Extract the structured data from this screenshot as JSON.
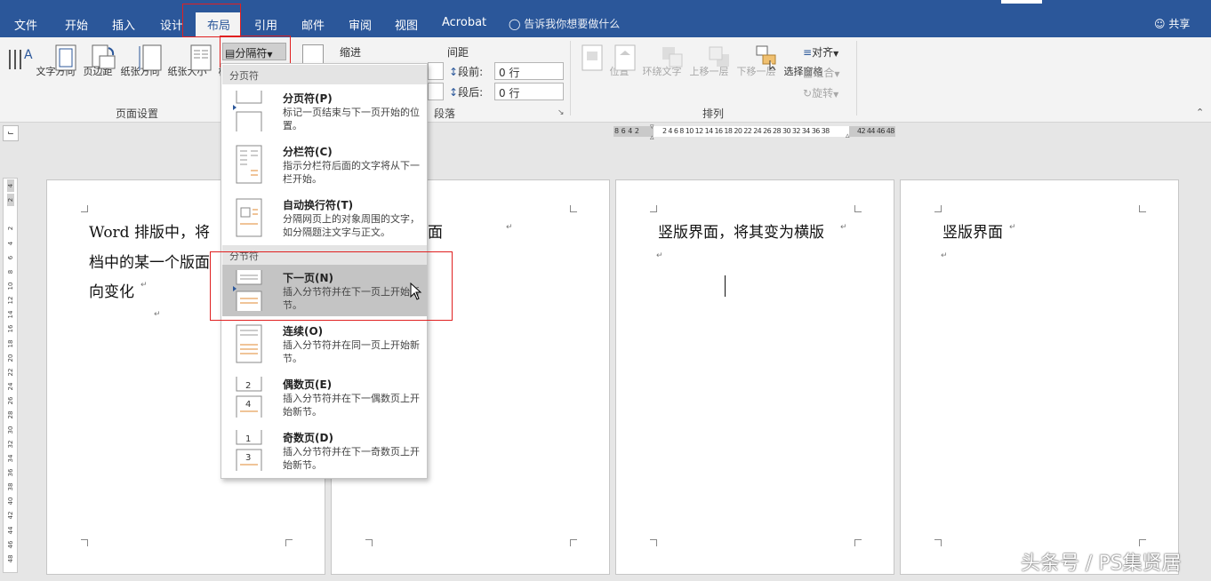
{
  "tabs": [
    "文件",
    "开始",
    "插入",
    "设计",
    "布局",
    "引用",
    "邮件",
    "审阅",
    "视图",
    "Acrobat"
  ],
  "tell_me": "告诉我你想要做什么",
  "share": "共享",
  "ribbon": {
    "text_direction": "文字方向",
    "margins": "页边距",
    "orientation": "纸张方向",
    "size": "纸张大小",
    "columns": "栏",
    "breaks": "分隔符",
    "page_setup_group": "页面设置",
    "indent": "缩进",
    "spacing": "间距",
    "before_label": "段前:",
    "after_label": "段后:",
    "before_value": "0 行",
    "after_value": "0 行",
    "paragraph_group": "段落",
    "position": "位置",
    "wrap_text": "环绕文字",
    "bring_forward": "上移一层",
    "send_backward": "下移一层",
    "selection_pane": "选择窗格",
    "align": "对齐",
    "group": "组合",
    "rotate": "旋转",
    "arrange_group": "排列"
  },
  "ruler": {
    "h_left": "8  6  4  2",
    "h_main": "2  4  6  8 10 12 14 16 18 20 22 24 26 28 30 32 34 36 38",
    "h_right": "42 44 46 48",
    "v_ticks": [
      "4",
      "2",
      "",
      "2",
      "4",
      "6",
      "8",
      "10",
      "12",
      "14",
      "16",
      "18",
      "20",
      "22",
      "24",
      "26",
      "28",
      "30",
      "32",
      "34",
      "36",
      "38",
      "40",
      "42",
      "44",
      "46",
      "48"
    ]
  },
  "dropdown": {
    "page_breaks_header": "分页符",
    "section_breaks_header": "分节符",
    "items": [
      {
        "title": "分页符(P)",
        "desc": "标记一页结束与下一页开始的位置。"
      },
      {
        "title": "分栏符(C)",
        "desc": "指示分栏符后面的文字将从下一栏开始。"
      },
      {
        "title": "自动换行符(T)",
        "desc": "分隔网页上的对象周围的文字，如分隔题注文字与正文。"
      },
      {
        "title": "下一页(N)",
        "desc": "插入分节符并在下一页上开始新节。"
      },
      {
        "title": "连续(O)",
        "desc": "插入分节符并在同一页上开始新节。"
      },
      {
        "title": "偶数页(E)",
        "desc": "插入分节符并在下一偶数页上开始新节。"
      },
      {
        "title": "奇数页(D)",
        "desc": "插入分节符并在下一奇数页上开始新节。"
      }
    ]
  },
  "document": {
    "page1_lines": [
      "Word 排版中，将",
      "档中的某一个版面",
      "向变化"
    ],
    "page2_text": "面",
    "page3_text": "竖版界面，将其变为横版",
    "page4_text": "竖版界面"
  },
  "watermark": "头条号 / PS集贤居",
  "colors": {
    "accent": "#2b579a",
    "highlight": "#e02020"
  }
}
